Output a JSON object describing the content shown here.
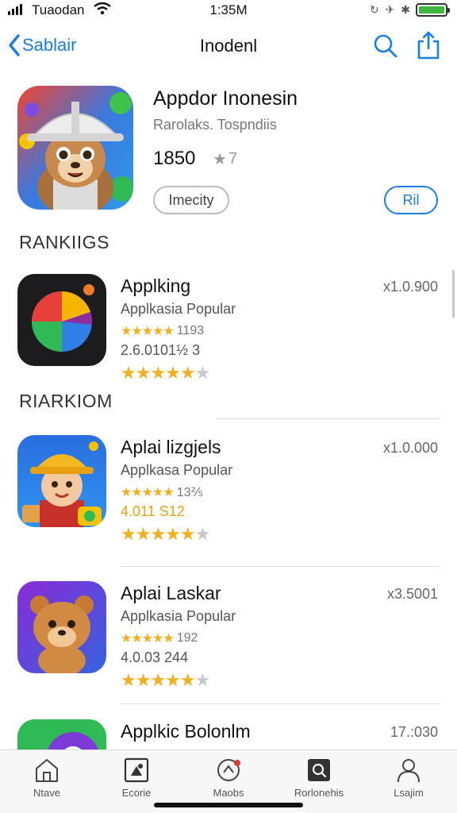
{
  "status_bar": {
    "carrier": "Tuaodan",
    "time": "1:35M",
    "icons_text": "↻ ✈ ✱"
  },
  "nav": {
    "back_label": "Sablair",
    "title": "Inodenl"
  },
  "featured": {
    "name": "Appdor Inonesin",
    "developer": "Rarolaks. Tospndiis",
    "rating_count": "1850",
    "star_text": "7",
    "get_label": "Imecity",
    "all_label": "Ril"
  },
  "sections": {
    "rankings": "RANKIIGS",
    "rankiom": "RIARKIOM"
  },
  "rows": [
    {
      "name": "Applking",
      "subtitle": "Applkasia Popular",
      "stars_count": "1193",
      "extra": "2.6.0101½ 3",
      "price": "x1.0.900"
    },
    {
      "name": "Aplai lizgjels",
      "subtitle": "Applkasa Popular",
      "stars_count": "13⅖",
      "extra": "4.011 S12",
      "price": "x1.0.000"
    },
    {
      "name": "Aplai Laskar",
      "subtitle": "Applkasia Popular",
      "stars_count": "192",
      "extra": "4.0.03 244",
      "price": "x3.5001"
    },
    {
      "name": "Applkic Bolonlm",
      "subtitle": "",
      "stars_count": "",
      "extra": "",
      "price": "17.:030"
    }
  ],
  "tabs": [
    {
      "label": "Ntave",
      "icon": "home-icon"
    },
    {
      "label": "Ecorie",
      "icon": "store-icon"
    },
    {
      "label": "Maobs",
      "icon": "rocket-icon"
    },
    {
      "label": "Rorlonehis",
      "icon": "search-tab-icon"
    },
    {
      "label": "Lsajim",
      "icon": "person-icon"
    }
  ],
  "colors": {
    "accent": "#1a7ee6",
    "star": "#f2b01e",
    "battery": "#41b53f"
  }
}
